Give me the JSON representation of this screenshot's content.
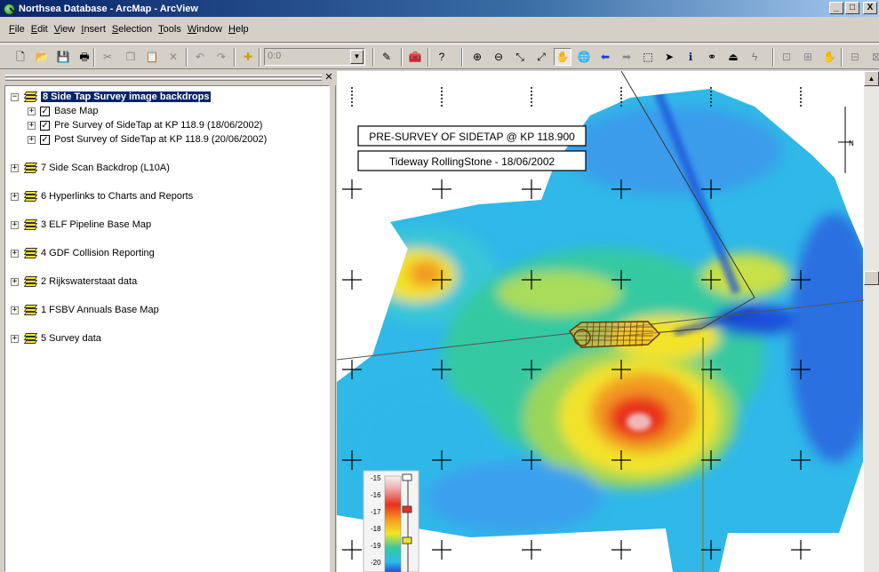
{
  "window": {
    "title": "Northsea Database - ArcMap - ArcView",
    "minimize": "_",
    "maximize": "□",
    "close": "X"
  },
  "menu": [
    "File",
    "Edit",
    "View",
    "Insert",
    "Selection",
    "Tools",
    "Window",
    "Help"
  ],
  "toolbar": {
    "scale_value": "0:0",
    "tools": [
      {
        "name": "new-document-icon",
        "glyph": "🗋"
      },
      {
        "name": "open-folder-icon",
        "glyph": "📂"
      },
      {
        "name": "save-icon",
        "glyph": "💾"
      },
      {
        "name": "print-icon",
        "glyph": "🖶"
      },
      {
        "name": "cut-icon",
        "glyph": "✂"
      },
      {
        "name": "copy-icon",
        "glyph": "❐"
      },
      {
        "name": "paste-icon",
        "glyph": "📋"
      },
      {
        "name": "delete-icon",
        "glyph": "✕"
      },
      {
        "name": "undo-icon",
        "glyph": "↶"
      },
      {
        "name": "redo-icon",
        "glyph": "↷"
      },
      {
        "name": "add-data-icon",
        "glyph": "✚"
      },
      {
        "name": "editor-toolbar-icon",
        "glyph": "✎"
      },
      {
        "name": "arctoolbox-icon",
        "glyph": "🧰"
      },
      {
        "name": "whats-this-help-icon",
        "glyph": "?"
      },
      {
        "name": "zoom-in-icon",
        "glyph": "⊕"
      },
      {
        "name": "zoom-out-icon",
        "glyph": "⊖"
      },
      {
        "name": "fixed-zoom-in-icon",
        "glyph": "⤡"
      },
      {
        "name": "fixed-zoom-out-icon",
        "glyph": "⤢"
      },
      {
        "name": "pan-hand-icon",
        "glyph": "✋"
      },
      {
        "name": "full-extent-globe-icon",
        "glyph": "🌐"
      },
      {
        "name": "back-arrow-icon",
        "glyph": "⬅"
      },
      {
        "name": "forward-arrow-icon",
        "glyph": "➡"
      },
      {
        "name": "select-features-icon",
        "glyph": "⬚"
      },
      {
        "name": "select-elements-arrow-icon",
        "glyph": "➤"
      },
      {
        "name": "identify-icon",
        "glyph": "ℹ"
      },
      {
        "name": "find-binoculars-icon",
        "glyph": "⚭"
      },
      {
        "name": "measure-icon",
        "glyph": "⏏"
      },
      {
        "name": "hyperlink-lightning-icon",
        "glyph": "ϟ"
      },
      {
        "name": "layout-tool-1-icon",
        "glyph": "⊡"
      },
      {
        "name": "layout-tool-2-icon",
        "glyph": "⊞"
      },
      {
        "name": "layout-tool-3-icon",
        "glyph": "✋"
      },
      {
        "name": "layout-tool-4-icon",
        "glyph": "⊟"
      },
      {
        "name": "layout-tool-5-icon",
        "glyph": "⊠"
      }
    ]
  },
  "toc": {
    "layers": [
      {
        "label": "8 Side Tap Survey image backdrops",
        "expanded": true,
        "selected": true,
        "children": [
          {
            "label": "Base Map",
            "checked": true
          },
          {
            "label": "Pre Survey of SideTap at KP 118.9 (18/06/2002)",
            "checked": true
          },
          {
            "label": "Post Survey of SideTap at KP 118.9 (20/06/2002)",
            "checked": true
          }
        ]
      },
      {
        "label": "7 Side Scan Backdrop (L10A)"
      },
      {
        "label": "6 Hyperlinks to Charts and Reports"
      },
      {
        "label": "3 ELF Pipeline Base Map"
      },
      {
        "label": "4 GDF Collision Reporting"
      },
      {
        "label": "2 Rijkswaterstaat data"
      },
      {
        "label": "1 FSBV Annuals Base Map"
      },
      {
        "label": "5 Survey data"
      }
    ]
  },
  "map": {
    "annotation_line1": "PRE-SURVEY OF SIDETAP @ KP 118.900",
    "annotation_line2": "Tideway RollingStone - 18/06/2002",
    "north_arrow_label": "N",
    "legend_labels": [
      "-15",
      "-16",
      "-17",
      "-18",
      "-19",
      "-20"
    ],
    "colors": {
      "deep": "#1a4fd9",
      "mid": "#2fb8e8",
      "shallow": "#35c9a2",
      "high": "#f2e32a",
      "peak": "#e8301c"
    }
  }
}
